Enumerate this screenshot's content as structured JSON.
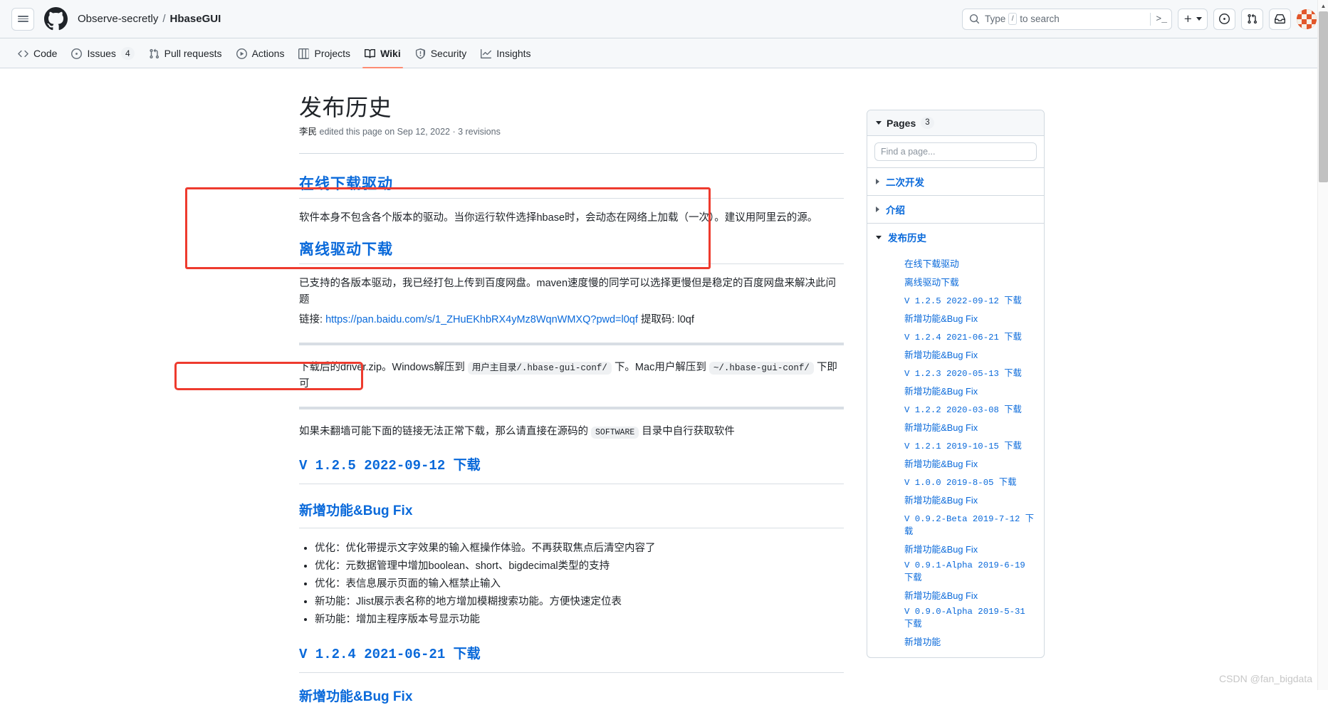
{
  "header": {
    "hamburger_label": "menu",
    "owner": "Observe-secretly",
    "separator": "/",
    "repo": "HbaseGUI",
    "search_placeholder_pre": "Type",
    "search_key": "/",
    "search_placeholder_post": "to search",
    "command_glyph": ">_",
    "plus_label": "+",
    "nav": [
      {
        "label": "Code",
        "icon": "code-icon",
        "selected": false,
        "count": ""
      },
      {
        "label": "Issues",
        "icon": "issue-opened-icon",
        "selected": false,
        "count": "4"
      },
      {
        "label": "Pull requests",
        "icon": "git-pull-request-icon",
        "selected": false,
        "count": ""
      },
      {
        "label": "Actions",
        "icon": "play-icon",
        "selected": false,
        "count": ""
      },
      {
        "label": "Projects",
        "icon": "table-icon",
        "selected": false,
        "count": ""
      },
      {
        "label": "Wiki",
        "icon": "book-icon",
        "selected": true,
        "count": ""
      },
      {
        "label": "Security",
        "icon": "shield-icon",
        "selected": false,
        "count": ""
      },
      {
        "label": "Insights",
        "icon": "graph-icon",
        "selected": false,
        "count": ""
      }
    ]
  },
  "wiki": {
    "title": "发布历史",
    "author": "李民",
    "meta_text": "edited this page on Sep 12, 2022 · 3 revisions",
    "section1_heading": "在线下载驱动",
    "section1_paragraph": "软件本身不包含各个版本的驱动。当你运行软件选择hbase时，会动态在网络上加载（一次）。建议用阿里云的源。",
    "section2_heading": "离线驱动下载",
    "section2_paragraph": "已支持的各版本驱动，我已经打包上传到百度网盘。maven速度慢的同学可以选择更慢但是稳定的百度网盘来解决此问题",
    "link_prefix": "链接:",
    "link_text": "https://pan.baidu.com/s/1_ZHuEKhbRX4yMz8WqnWMXQ?pwd=l0qf",
    "link_suffix": "提取码: l0qf",
    "unzip_pre": "下载后的driver.zip。Windows解压到",
    "unzip_code1": "用户主目录/.hbase-gui-conf/",
    "unzip_mid": "下。Mac用户解压到",
    "unzip_code2": "~/.hbase-gui-conf/",
    "unzip_post": "下即可",
    "vpn_pre": "如果未翻墙可能下面的链接无法正常下载，那么请直接在源码的",
    "vpn_code": "SOFTWARE",
    "vpn_post": "目录中自行获取软件",
    "release_125": "V 1.2.5 2022-09-12 下载",
    "feat_heading": "新增功能&Bug Fix",
    "feat_items": [
      "优化：优化带提示文字效果的输入框操作体验。不再获取焦点后清空内容了",
      "优化：元数据管理中增加boolean、short、bigdecimal类型的支持",
      "优化：表信息展示页面的输入框禁止输入",
      "新功能：Jlist展示表名称的地方增加模糊搜索功能。方便快速定位表",
      "新功能：增加主程序版本号显示功能"
    ],
    "release_124": "V 1.2.4 2021-06-21 下载",
    "feat_heading2": "新增功能&Bug Fix"
  },
  "pages_panel": {
    "header_label": "Pages",
    "header_count": "3",
    "search_placeholder": "Find a page...",
    "groups": [
      {
        "label": "二次开发",
        "expanded": false,
        "children": []
      },
      {
        "label": "介绍",
        "expanded": false,
        "children": []
      },
      {
        "label": "发布历史",
        "expanded": true,
        "children": [
          {
            "label": "在线下载驱动",
            "mono": false
          },
          {
            "label": "离线驱动下载",
            "mono": false
          },
          {
            "label": "V 1.2.5 2022-09-12 下载",
            "mono": true
          },
          {
            "label": "新增功能&Bug Fix",
            "mono": false
          },
          {
            "label": "V 1.2.4 2021-06-21 下载",
            "mono": true
          },
          {
            "label": "新增功能&Bug Fix",
            "mono": false
          },
          {
            "label": "V 1.2.3 2020-05-13 下载",
            "mono": true
          },
          {
            "label": "新增功能&Bug Fix",
            "mono": false
          },
          {
            "label": "V 1.2.2 2020-03-08 下载",
            "mono": true
          },
          {
            "label": "新增功能&Bug Fix",
            "mono": false
          },
          {
            "label": "V 1.2.1 2019-10-15 下载",
            "mono": true
          },
          {
            "label": "新增功能&Bug Fix",
            "mono": false
          },
          {
            "label": "V 1.0.0 2019-8-05 下载",
            "mono": true
          },
          {
            "label": "新增功能&Bug Fix",
            "mono": false
          },
          {
            "label": "V 0.9.2-Beta 2019-7-12 下载",
            "mono": true
          },
          {
            "label": "新增功能&Bug Fix",
            "mono": false
          },
          {
            "label": "V 0.9.1-Alpha 2019-6-19 下载",
            "mono": true
          },
          {
            "label": "新增功能&Bug Fix",
            "mono": false
          },
          {
            "label": "V 0.9.0-Alpha 2019-5-31 下载",
            "mono": true
          },
          {
            "label": "新增功能",
            "mono": false
          }
        ]
      }
    ]
  },
  "watermark": "CSDN @fan_bigdata",
  "colors": {
    "accent": "#0969da",
    "annotation": "#ee3b2e",
    "tab_underline": "#fd8c73",
    "header_bg": "#f6f8fa",
    "border": "#d1d9e0"
  }
}
